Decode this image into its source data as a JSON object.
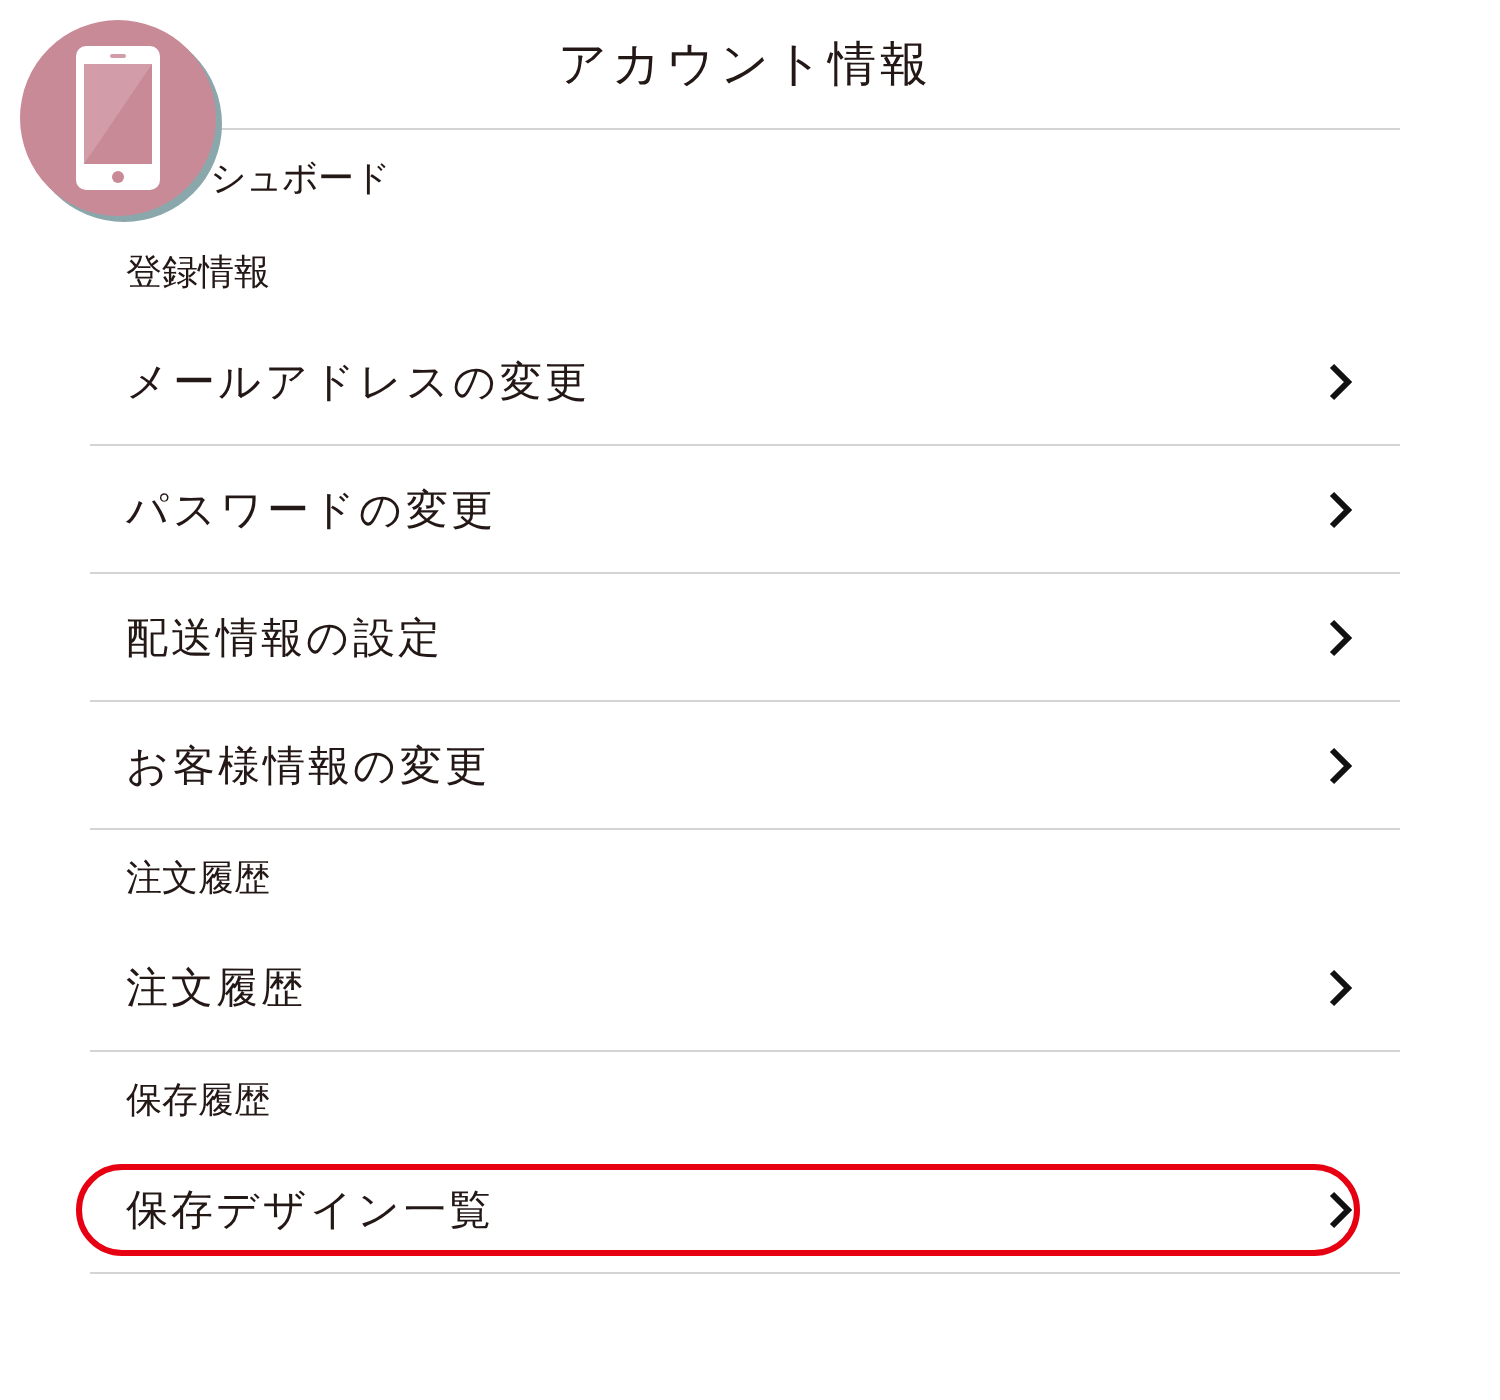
{
  "title": "アカウント情報",
  "items": [
    {
      "kind": "heading",
      "label": "シュボード"
    },
    {
      "kind": "heading",
      "label": "登録情報"
    },
    {
      "kind": "link",
      "label": "メールアドレスの変更",
      "highlighted": false
    },
    {
      "kind": "link",
      "label": "パスワードの変更",
      "highlighted": false
    },
    {
      "kind": "link",
      "label": "配送情報の設定",
      "highlighted": false
    },
    {
      "kind": "link",
      "label": "お客様情報の変更",
      "highlighted": false
    },
    {
      "kind": "heading",
      "label": "注文履歴"
    },
    {
      "kind": "link",
      "label": "注文履歴",
      "highlighted": false
    },
    {
      "kind": "heading",
      "label": "保存履歴"
    },
    {
      "kind": "link",
      "label": "保存デザイン一覧",
      "highlighted": true
    }
  ]
}
